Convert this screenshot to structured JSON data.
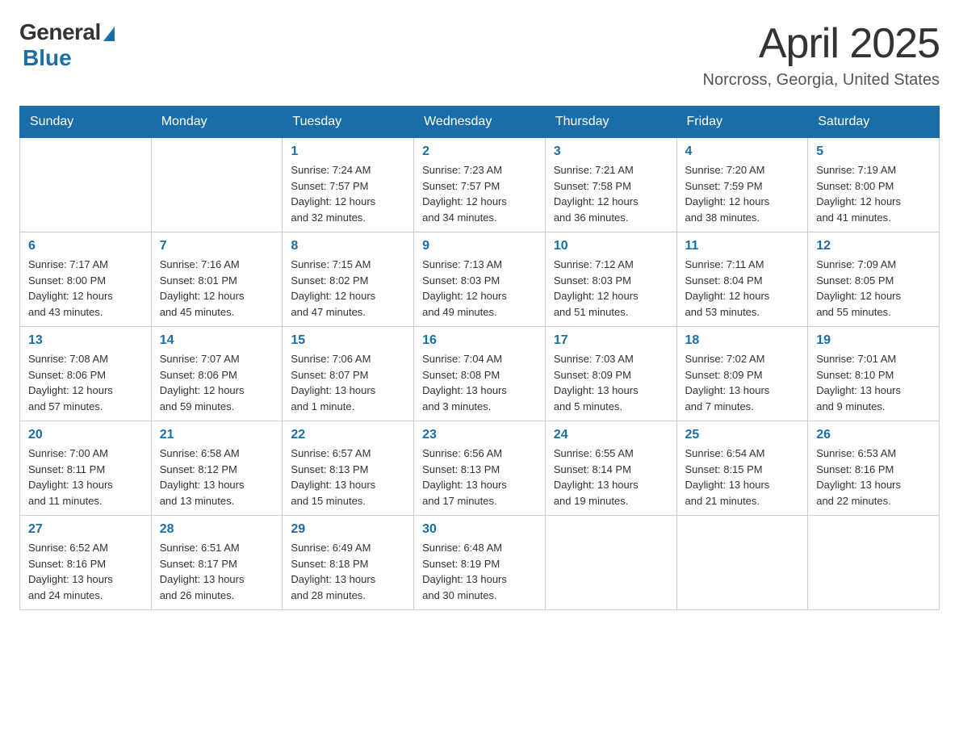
{
  "header": {
    "logo_general": "General",
    "logo_blue": "Blue",
    "month_title": "April 2025",
    "location": "Norcross, Georgia, United States"
  },
  "days_of_week": [
    "Sunday",
    "Monday",
    "Tuesday",
    "Wednesday",
    "Thursday",
    "Friday",
    "Saturday"
  ],
  "weeks": [
    [
      {
        "num": "",
        "info": ""
      },
      {
        "num": "",
        "info": ""
      },
      {
        "num": "1",
        "info": "Sunrise: 7:24 AM\nSunset: 7:57 PM\nDaylight: 12 hours\nand 32 minutes."
      },
      {
        "num": "2",
        "info": "Sunrise: 7:23 AM\nSunset: 7:57 PM\nDaylight: 12 hours\nand 34 minutes."
      },
      {
        "num": "3",
        "info": "Sunrise: 7:21 AM\nSunset: 7:58 PM\nDaylight: 12 hours\nand 36 minutes."
      },
      {
        "num": "4",
        "info": "Sunrise: 7:20 AM\nSunset: 7:59 PM\nDaylight: 12 hours\nand 38 minutes."
      },
      {
        "num": "5",
        "info": "Sunrise: 7:19 AM\nSunset: 8:00 PM\nDaylight: 12 hours\nand 41 minutes."
      }
    ],
    [
      {
        "num": "6",
        "info": "Sunrise: 7:17 AM\nSunset: 8:00 PM\nDaylight: 12 hours\nand 43 minutes."
      },
      {
        "num": "7",
        "info": "Sunrise: 7:16 AM\nSunset: 8:01 PM\nDaylight: 12 hours\nand 45 minutes."
      },
      {
        "num": "8",
        "info": "Sunrise: 7:15 AM\nSunset: 8:02 PM\nDaylight: 12 hours\nand 47 minutes."
      },
      {
        "num": "9",
        "info": "Sunrise: 7:13 AM\nSunset: 8:03 PM\nDaylight: 12 hours\nand 49 minutes."
      },
      {
        "num": "10",
        "info": "Sunrise: 7:12 AM\nSunset: 8:03 PM\nDaylight: 12 hours\nand 51 minutes."
      },
      {
        "num": "11",
        "info": "Sunrise: 7:11 AM\nSunset: 8:04 PM\nDaylight: 12 hours\nand 53 minutes."
      },
      {
        "num": "12",
        "info": "Sunrise: 7:09 AM\nSunset: 8:05 PM\nDaylight: 12 hours\nand 55 minutes."
      }
    ],
    [
      {
        "num": "13",
        "info": "Sunrise: 7:08 AM\nSunset: 8:06 PM\nDaylight: 12 hours\nand 57 minutes."
      },
      {
        "num": "14",
        "info": "Sunrise: 7:07 AM\nSunset: 8:06 PM\nDaylight: 12 hours\nand 59 minutes."
      },
      {
        "num": "15",
        "info": "Sunrise: 7:06 AM\nSunset: 8:07 PM\nDaylight: 13 hours\nand 1 minute."
      },
      {
        "num": "16",
        "info": "Sunrise: 7:04 AM\nSunset: 8:08 PM\nDaylight: 13 hours\nand 3 minutes."
      },
      {
        "num": "17",
        "info": "Sunrise: 7:03 AM\nSunset: 8:09 PM\nDaylight: 13 hours\nand 5 minutes."
      },
      {
        "num": "18",
        "info": "Sunrise: 7:02 AM\nSunset: 8:09 PM\nDaylight: 13 hours\nand 7 minutes."
      },
      {
        "num": "19",
        "info": "Sunrise: 7:01 AM\nSunset: 8:10 PM\nDaylight: 13 hours\nand 9 minutes."
      }
    ],
    [
      {
        "num": "20",
        "info": "Sunrise: 7:00 AM\nSunset: 8:11 PM\nDaylight: 13 hours\nand 11 minutes."
      },
      {
        "num": "21",
        "info": "Sunrise: 6:58 AM\nSunset: 8:12 PM\nDaylight: 13 hours\nand 13 minutes."
      },
      {
        "num": "22",
        "info": "Sunrise: 6:57 AM\nSunset: 8:13 PM\nDaylight: 13 hours\nand 15 minutes."
      },
      {
        "num": "23",
        "info": "Sunrise: 6:56 AM\nSunset: 8:13 PM\nDaylight: 13 hours\nand 17 minutes."
      },
      {
        "num": "24",
        "info": "Sunrise: 6:55 AM\nSunset: 8:14 PM\nDaylight: 13 hours\nand 19 minutes."
      },
      {
        "num": "25",
        "info": "Sunrise: 6:54 AM\nSunset: 8:15 PM\nDaylight: 13 hours\nand 21 minutes."
      },
      {
        "num": "26",
        "info": "Sunrise: 6:53 AM\nSunset: 8:16 PM\nDaylight: 13 hours\nand 22 minutes."
      }
    ],
    [
      {
        "num": "27",
        "info": "Sunrise: 6:52 AM\nSunset: 8:16 PM\nDaylight: 13 hours\nand 24 minutes."
      },
      {
        "num": "28",
        "info": "Sunrise: 6:51 AM\nSunset: 8:17 PM\nDaylight: 13 hours\nand 26 minutes."
      },
      {
        "num": "29",
        "info": "Sunrise: 6:49 AM\nSunset: 8:18 PM\nDaylight: 13 hours\nand 28 minutes."
      },
      {
        "num": "30",
        "info": "Sunrise: 6:48 AM\nSunset: 8:19 PM\nDaylight: 13 hours\nand 30 minutes."
      },
      {
        "num": "",
        "info": ""
      },
      {
        "num": "",
        "info": ""
      },
      {
        "num": "",
        "info": ""
      }
    ]
  ]
}
